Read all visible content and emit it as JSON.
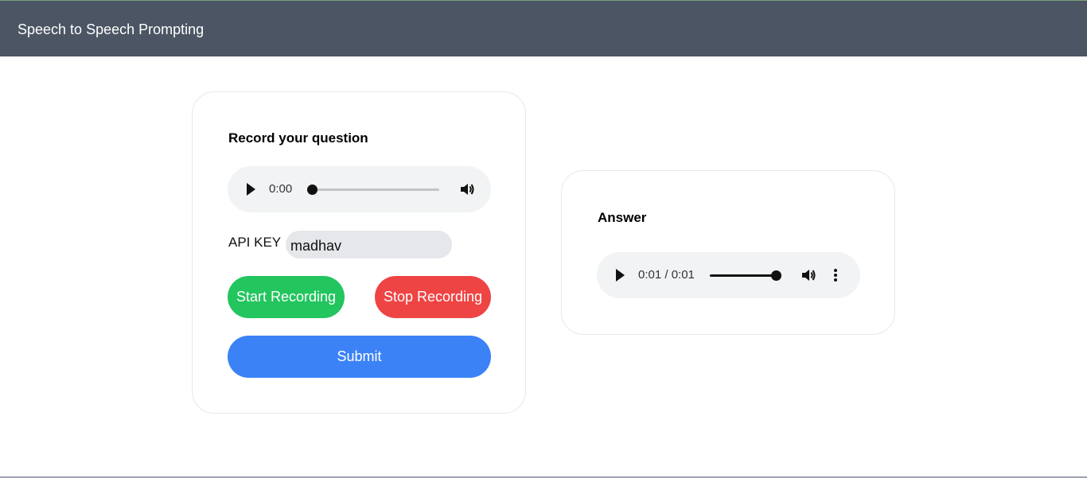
{
  "header": {
    "title": "Speech to Speech Prompting"
  },
  "record_card": {
    "title": "Record your question",
    "player": {
      "time": "0:00",
      "progress": 0
    },
    "api_key_label": "API KEY",
    "api_key_value": "madhav",
    "start_label": "Start Recording",
    "stop_label": "Stop Recording",
    "submit_label": "Submit"
  },
  "answer_card": {
    "title": "Answer",
    "player": {
      "time": "0:01 / 0:01",
      "progress": 1
    }
  },
  "colors": {
    "header_bg": "#4b5563",
    "start": "#22c55e",
    "stop": "#ef4444",
    "submit": "#3b82f6"
  },
  "icons": [
    "play-icon",
    "volume-icon",
    "more-options-icon"
  ]
}
